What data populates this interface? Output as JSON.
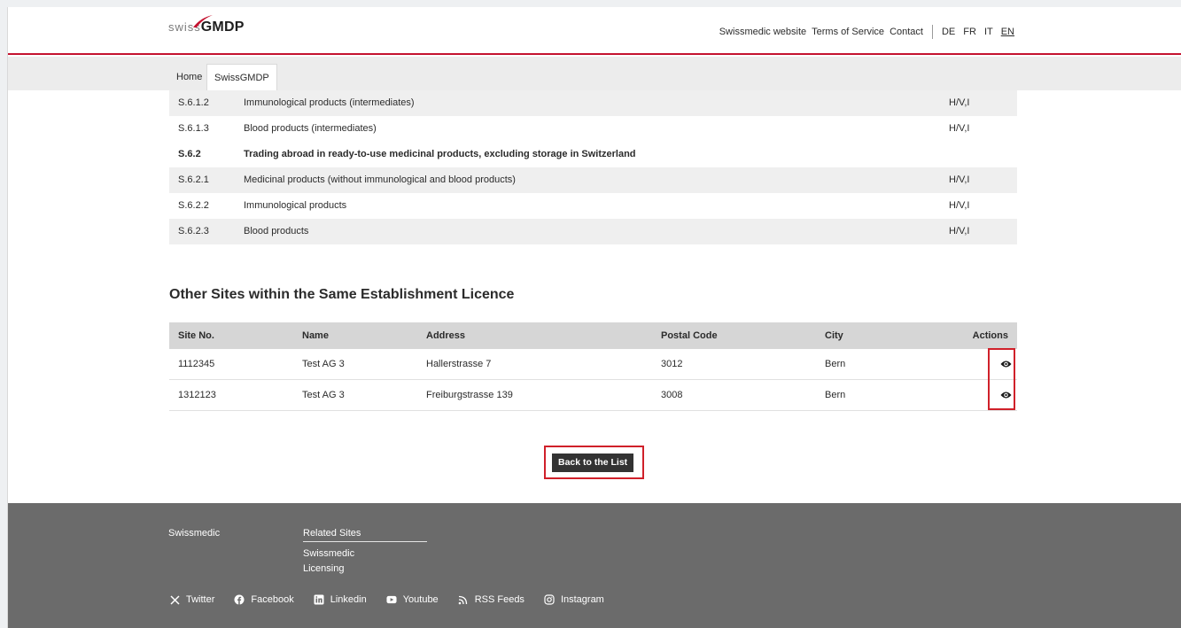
{
  "header": {
    "logo_swiss": "swiss",
    "logo_gmdp": "GMDP",
    "nav": [
      "Swissmedic website",
      "Terms of Service",
      "Contact"
    ],
    "languages": [
      "DE",
      "FR",
      "IT",
      "EN"
    ],
    "active_language": "EN",
    "accent_color": "#c4122f"
  },
  "breadcrumb": {
    "home": "Home",
    "current": "SwissGMDP"
  },
  "categories": [
    {
      "code": "S.6.1.2",
      "label": "Immunological products (intermediates)",
      "value": "H/V,I"
    },
    {
      "code": "S.6.1.3",
      "label": "Blood products (intermediates)",
      "value": "H/V,I"
    },
    {
      "code": "S.6.2",
      "label": "Trading abroad in ready-to-use medicinal products, excluding storage in Switzerland",
      "value": ""
    },
    {
      "code": "S.6.2.1",
      "label": "Medicinal products (without immunological and blood products)",
      "value": "H/V,I"
    },
    {
      "code": "S.6.2.2",
      "label": "Immunological products",
      "value": "H/V,I"
    },
    {
      "code": "S.6.2.3",
      "label": "Blood products",
      "value": "H/V,I"
    }
  ],
  "sites_section": {
    "title": "Other Sites within the Same Establishment Licence",
    "columns": [
      "Site No.",
      "Name",
      "Address",
      "Postal Code",
      "City",
      "Actions"
    ],
    "rows": [
      {
        "site_no": "1112345",
        "name": "Test AG 3",
        "address": "Hallerstrasse 7",
        "postal_code": "3012",
        "city": "Bern",
        "action_icon": "eye-icon"
      },
      {
        "site_no": "1312123",
        "name": "Test AG 3",
        "address": "Freiburgstrasse 139",
        "postal_code": "3008",
        "city": "Bern",
        "action_icon": "eye-icon"
      }
    ]
  },
  "back_button": "Back to the List",
  "footer": {
    "brand": "Swissmedic",
    "related_title": "Related Sites",
    "related_links": [
      "Swissmedic",
      "Licensing"
    ],
    "social": [
      {
        "icon": "x-icon",
        "label": "Twitter"
      },
      {
        "icon": "facebook-icon",
        "label": "Facebook"
      },
      {
        "icon": "linkedin-icon",
        "label": "Linkedin"
      },
      {
        "icon": "youtube-icon",
        "label": "Youtube"
      },
      {
        "icon": "rss-icon",
        "label": "RSS Feeds"
      },
      {
        "icon": "instagram-icon",
        "label": "Instagram"
      }
    ]
  }
}
